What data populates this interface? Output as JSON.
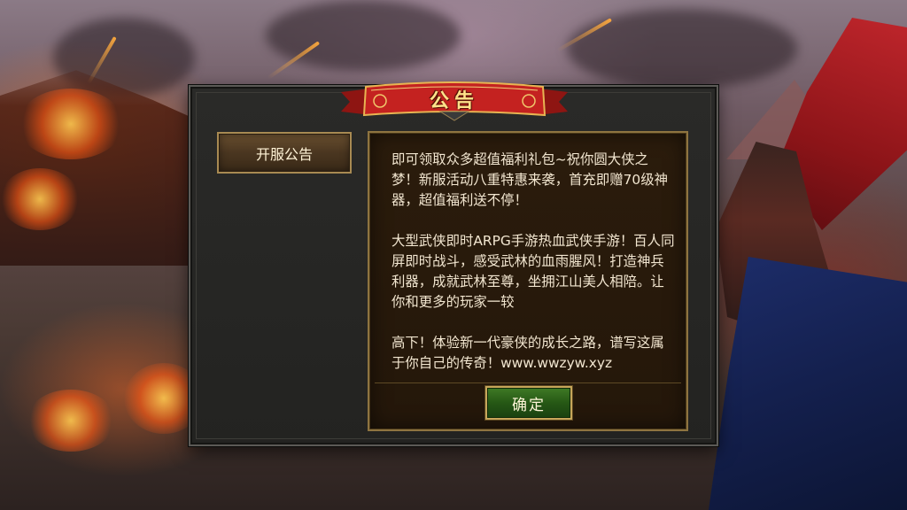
{
  "dialog": {
    "title": "公告",
    "tabs": [
      {
        "label": "开服公告",
        "active": true
      }
    ],
    "content": {
      "cut_line": "......",
      "paragraphs": [
        "即可领取众多超值福利礼包~祝你圆大侠之梦！新服活动八重特惠来袭，首充即赠70级神器，超值福利送不停！",
        "大型武侠即时ARPG手游热血武侠手游！百人同屏即时战斗，感受武林的血雨腥风！打造神兵利器，成就武林至尊，坐拥江山美人相陪。让你和更多的玩家一较",
        "高下！体验新一代豪侠的成长之路，谱写这属于你自己的传奇！www.wwzyw.xyz"
      ]
    },
    "confirm_label": "确定"
  },
  "colors": {
    "banner_red": "#b8201e",
    "banner_gold": "#e0b050",
    "title_text": "#ffe28a",
    "panel_border": "#8e7440",
    "confirm_green": "#2f6a1c"
  }
}
